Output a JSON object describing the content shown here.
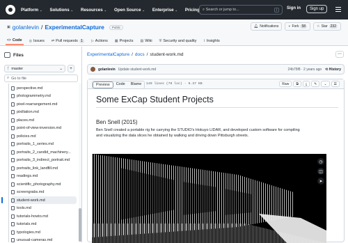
{
  "nav": {
    "items": [
      {
        "label": "Platform",
        "caret": "⌄"
      },
      {
        "label": "Solutions",
        "caret": "⌄"
      },
      {
        "label": "Resources",
        "caret": "⌄"
      },
      {
        "label": "Open Source",
        "caret": "⌄"
      },
      {
        "label": "Enterprise",
        "caret": "⌄"
      },
      {
        "label": "Pricing",
        "caret": ""
      }
    ],
    "search_placeholder": "Search or jump to...",
    "search_key": "/",
    "signin": "Sign in",
    "signup": "Sign up"
  },
  "repo": {
    "owner": "golanlevin",
    "sep": "/",
    "name": "ExperimentalCapture",
    "visibility": "Public",
    "notifications": "Notifications",
    "fork": "Fork",
    "fork_count": "58",
    "star": "Star",
    "star_count": "232",
    "tabs": [
      {
        "label": "Code",
        "icon": "<>"
      },
      {
        "label": "Issues",
        "icon": "◎"
      },
      {
        "label": "Pull requests",
        "icon": "⇄",
        "count": "1"
      },
      {
        "label": "Actions",
        "icon": "▷"
      },
      {
        "label": "Projects",
        "icon": "▦"
      },
      {
        "label": "Wiki",
        "icon": "▤"
      },
      {
        "label": "Security and quality",
        "icon": "⛨"
      },
      {
        "label": "Insights",
        "icon": "⌇"
      }
    ]
  },
  "sidebar": {
    "title": "Files",
    "branch": "master",
    "branch_icon": "ᚴ",
    "branch_caret": "⌄",
    "add": "+",
    "search_btn": "⌕",
    "go_to_file": "Go to file",
    "search_icon": "⌕",
    "files": [
      "perspective.md",
      "photogrammetry.md",
      "pixel-rearrangement.md",
      "pixillation.md",
      "places.md",
      "point-of-view-inversion.md",
      "policies.md",
      "portraits_1_series.md",
      "portraits_2_candid_machinery...",
      "portraits_3_indirect_portrait.md",
      "portraits_link_landfill.md",
      "readings.md",
      "scientific_photography.md",
      "screengrabs.md",
      "student-work.md",
      "tools.md",
      "tutorials-howto.md",
      "tutorials.md",
      "typologies.md",
      "unusual-cameras.md"
    ],
    "active_index": 14
  },
  "breadcrumb": {
    "repo": "ExperimentalCapture",
    "folder": "docs",
    "file": "student-work.md",
    "sep": "/"
  },
  "commit": {
    "author": "golanlevin",
    "message": "Update student-work.md",
    "hash": "24b75f8 · 2 years ago",
    "history": "History"
  },
  "file": {
    "tab_preview": "Preview",
    "tab_code": "Code",
    "tab_blame": "Blame",
    "meta": "149 lines (79 loc) · 9.37 KB",
    "raw": "Raw",
    "copy": "⧉",
    "download": "⤓",
    "edit": "✎",
    "caret": "⌄",
    "list": "☰",
    "dots": "⋯"
  },
  "article": {
    "h1": "Some ExCap Student Projects",
    "h2": "Ben Snell (2015)",
    "p": "Ben Snell created a portable rig for carrying the STUDIO's Hokuyo LIDAR, and developed custom software for compiling and visualizing the data slices he obtained by walking and driving down Pittsburgh streets."
  },
  "overlay": {
    "clock": "◷",
    "layers": "◫",
    "send": "➤"
  }
}
